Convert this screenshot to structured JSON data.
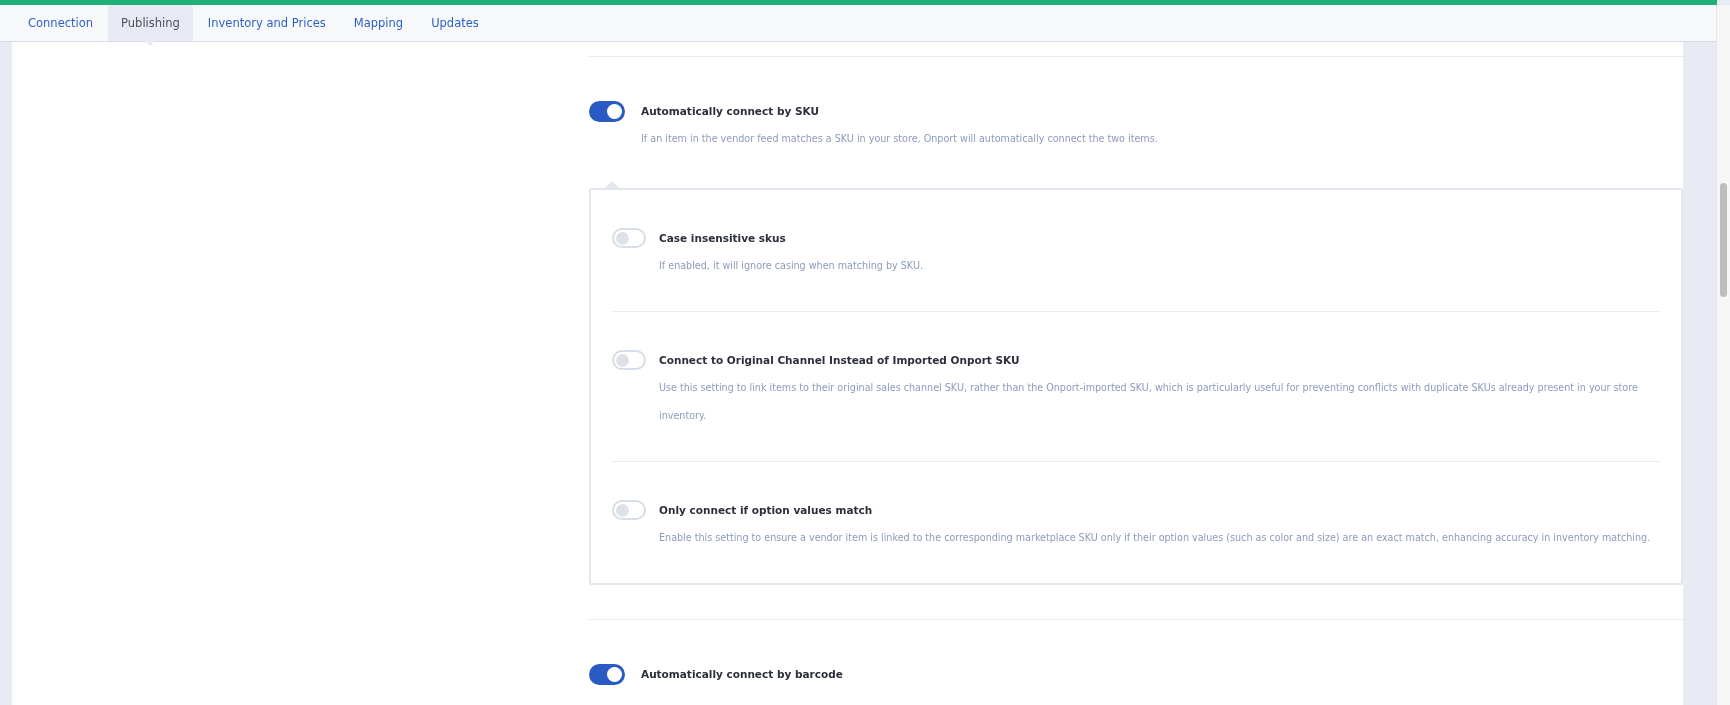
{
  "tabs": [
    {
      "label": "Connection",
      "selected": false
    },
    {
      "label": "Publishing",
      "selected": true
    },
    {
      "label": "Inventory and Prices",
      "selected": false
    },
    {
      "label": "Mapping",
      "selected": false
    },
    {
      "label": "Updates",
      "selected": false
    }
  ],
  "settings": [
    {
      "title": "Automatically connect by SKU",
      "description": "If an item in the vendor feed matches a SKU in your store, Onport will automatically connect the two items.",
      "on": true,
      "children": [
        {
          "title": "Case insensitive skus",
          "description": "If enabled, it will ignore casing when matching by SKU.",
          "on": false
        },
        {
          "title": "Connect to Original Channel Instead of Imported Onport SKU",
          "description": "Use this setting to link items to their original sales channel SKU, rather than the Onport-imported SKU, which is particularly useful for preventing conflicts with duplicate SKUs already present in your store inventory.",
          "on": false
        },
        {
          "title": "Only connect if option values match",
          "description": "Enable this setting to ensure a vendor item is linked to the corresponding marketplace SKU only if their option values (such as color and size) are an exact match, enhancing accuracy in inventory matching.",
          "on": false
        }
      ]
    },
    {
      "title": "Automatically connect by barcode",
      "on": true
    }
  ]
}
